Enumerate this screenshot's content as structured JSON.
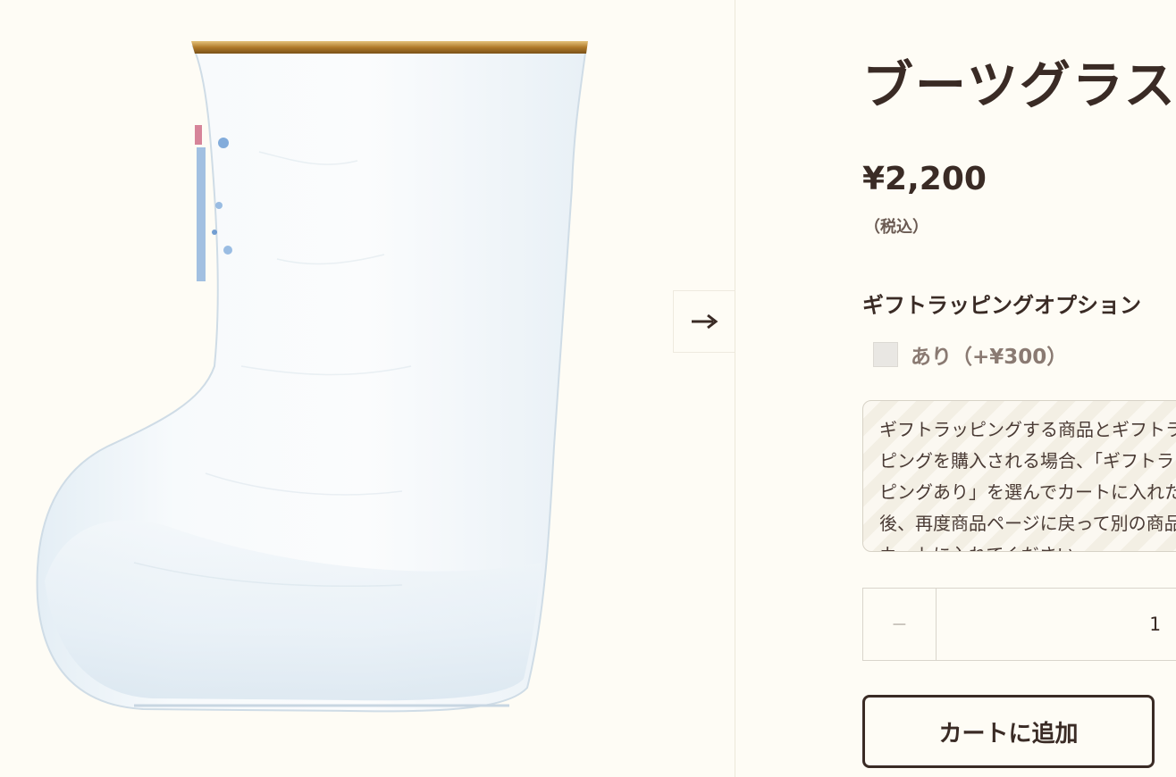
{
  "product": {
    "title": "ブーツグラス",
    "price": "¥2,200",
    "tax_note": "（税込）",
    "image_alt": "boot-shaped glass"
  },
  "gallery": {
    "next_arrow": "→"
  },
  "gift_option": {
    "title": "ギフトラッピングオプション",
    "label": "あり（+¥300）",
    "checked": false,
    "note": "ギフトラッピングする商品とギフトラッピングを購入される場合、「ギフトラッピングあり」を選んでカートに入れた後、再度商品ページに戻って別の商品をカートに入れてください"
  },
  "quantity": {
    "minus": "−",
    "value": "1"
  },
  "cart": {
    "add_label": "カートに追加"
  },
  "colors": {
    "background": "#fefcf5",
    "text": "#3a2b25",
    "rim_gold": "#b8862f"
  }
}
